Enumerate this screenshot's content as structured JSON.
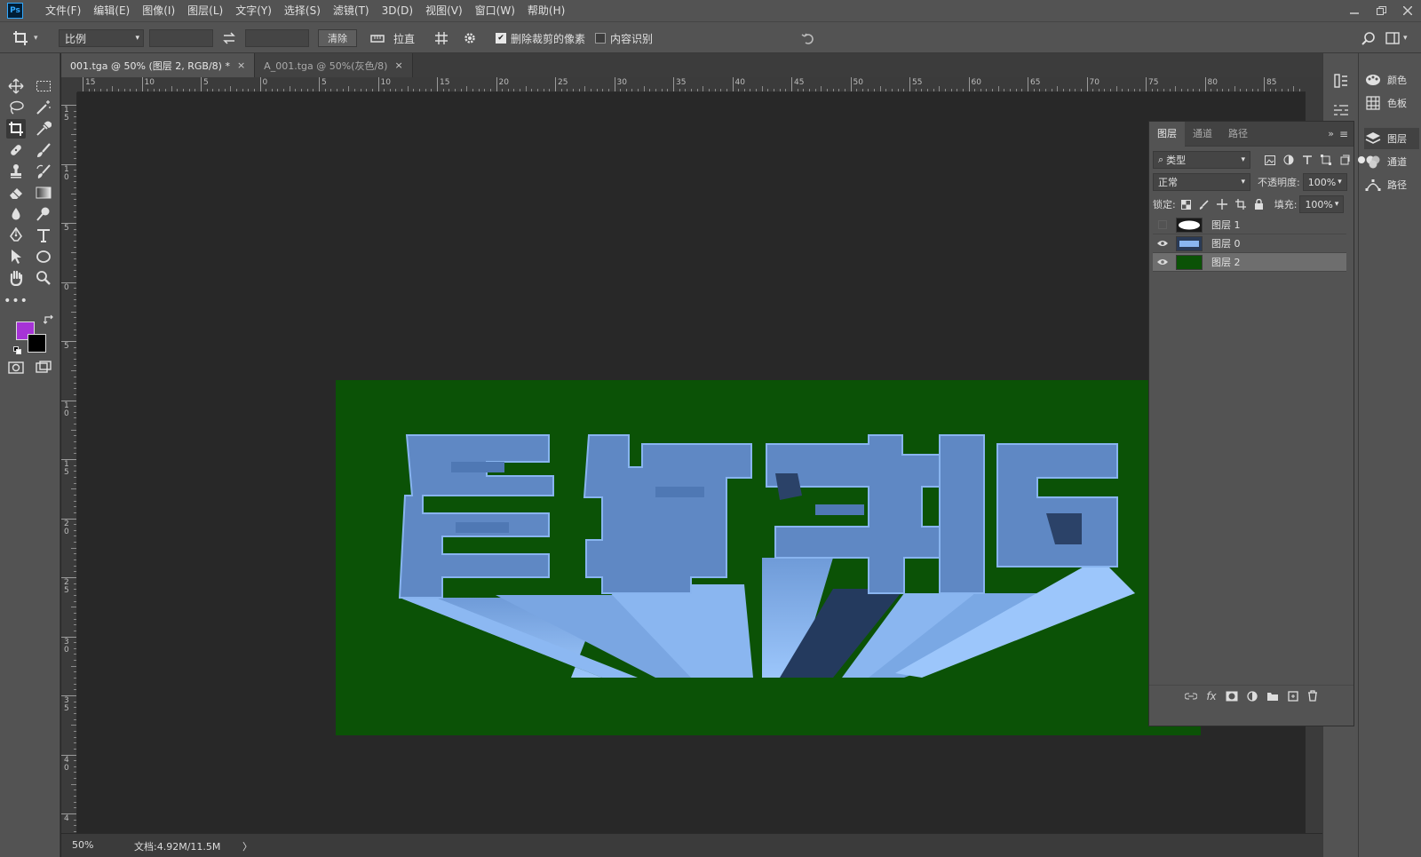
{
  "app": {
    "logo_text": "Ps"
  },
  "menu": [
    {
      "label": "文件(F)"
    },
    {
      "label": "编辑(E)"
    },
    {
      "label": "图像(I)"
    },
    {
      "label": "图层(L)"
    },
    {
      "label": "文字(Y)"
    },
    {
      "label": "选择(S)"
    },
    {
      "label": "滤镜(T)"
    },
    {
      "label": "3D(D)"
    },
    {
      "label": "视图(V)"
    },
    {
      "label": "窗口(W)"
    },
    {
      "label": "帮助(H)"
    }
  ],
  "options": {
    "ratio_select": "比例",
    "clear_button": "清除",
    "straighten_label": "拉直",
    "delete_cropped_label": "删除裁剪的像素",
    "delete_cropped_checked": true,
    "content_aware_label": "内容识别",
    "content_aware_checked": false
  },
  "tabs": [
    {
      "label": "001.tga @ 50% (图层 2, RGB/8) *",
      "close": "×",
      "active": true
    },
    {
      "label": "A_001.tga @ 50%(灰色/8)",
      "close": "×",
      "active": false
    }
  ],
  "rulers": {
    "h_labels": [
      "15",
      "10",
      "5",
      "0",
      "5",
      "10",
      "15",
      "20",
      "25",
      "30",
      "35",
      "40",
      "45",
      "50",
      "55",
      "60",
      "65",
      "70",
      "75",
      "80",
      "85"
    ],
    "v_labels": [
      "1\n5",
      "1\n0",
      "5",
      "0",
      "5",
      "1\n0",
      "1\n5",
      "2\n0",
      "2\n5",
      "3\n0",
      "3\n5",
      "4\n0",
      "4"
    ]
  },
  "canvas": {
    "background_color": "#0b5206",
    "artwork_text": "震撼来临",
    "text_face_color": "#5f88c4",
    "text_extrude_color": "#86b6f2"
  },
  "colors": {
    "foreground": "#a633d6",
    "background": "#000000"
  },
  "status": {
    "zoom": "50%",
    "doc_info": "文档:4.92M/11.5M",
    "arrow": "〉"
  },
  "dock": {
    "color": "颜色",
    "swatches": "色板",
    "layers": "图层",
    "channels": "通道",
    "paths": "路径"
  },
  "layers_panel": {
    "tabs": [
      "图层",
      "通道",
      "路径"
    ],
    "filter_kind": "类型",
    "blend_mode": "正常",
    "opacity_label": "不透明度:",
    "opacity_value": "100%",
    "lock_label": "锁定:",
    "fill_label": "填充:",
    "fill_value": "100%",
    "layers": [
      {
        "name": "图层 1",
        "visible": false,
        "selected": false,
        "thumb": "mask"
      },
      {
        "name": "图层 0",
        "visible": true,
        "selected": false,
        "thumb": "text"
      },
      {
        "name": "图层 2",
        "visible": true,
        "selected": true,
        "thumb": "green"
      }
    ]
  }
}
